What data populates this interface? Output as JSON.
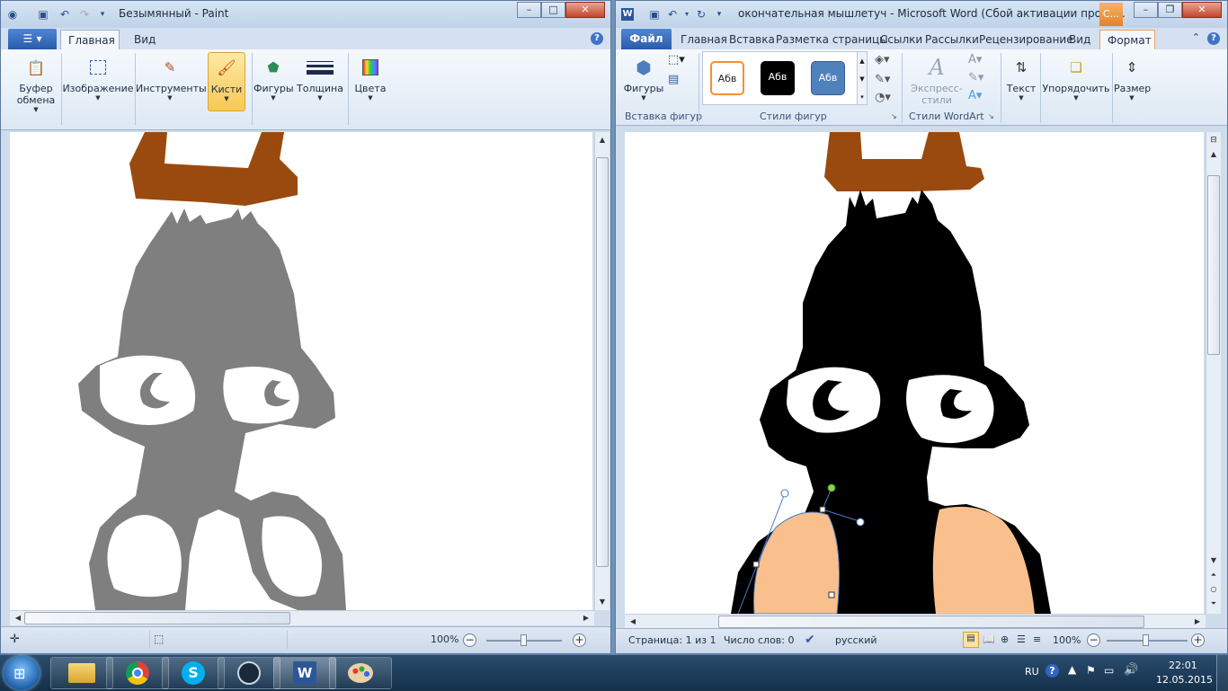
{
  "paint": {
    "title": "Безымянный - Paint",
    "tabs": [
      "Главная",
      "Вид"
    ],
    "groups": [
      {
        "label": "Буфер\nобмена",
        "icon": "clipboard-icon"
      },
      {
        "label": "Изображение",
        "icon": "select-icon"
      },
      {
        "label": "Инструменты",
        "icon": "tools-icon"
      },
      {
        "label": "Кисти",
        "icon": "brush-icon"
      },
      {
        "label": "Фигуры",
        "icon": "shapes-icon"
      },
      {
        "label": "Толщина",
        "icon": "thickness-icon"
      },
      {
        "label": "Цвета",
        "icon": "colors-icon"
      }
    ],
    "status": {
      "zoom": "100%"
    }
  },
  "word": {
    "title": "окончательная мышлетуч  -  Microsoft Word (Сбой активации проду...",
    "context_tab": "С...",
    "file_tab": "Файл",
    "tabs": [
      "Главная",
      "Вставка",
      "Разметка страницы",
      "Ссылки",
      "Рассылки",
      "Рецензирование",
      "Вид",
      "Формат"
    ],
    "groups": {
      "insert_shapes": {
        "label": "Вставка фигур",
        "shapes_button": "Фигуры"
      },
      "shape_styles": {
        "label": "Стили фигур",
        "styles": [
          "Абв",
          "Абв",
          "Абв"
        ]
      },
      "wordart": {
        "label": "Стили WordArt",
        "express_styles": "Экспресс-\nстили"
      },
      "text": {
        "label": "Текст"
      },
      "arrange": {
        "label": "Упорядочить"
      },
      "size": {
        "label": "Размер"
      }
    },
    "status": {
      "page": "Страница: 1 из 1",
      "words": "Число слов: 0",
      "language": "русский",
      "zoom": "100%"
    }
  },
  "taskbar": {
    "language": "RU",
    "time": "22:01",
    "date": "12.05.2015",
    "apps": [
      "explorer",
      "chrome",
      "skype",
      "steam",
      "word",
      "paint"
    ]
  },
  "colors": {
    "brown": "#9a4a0e",
    "gray": "#7f7f7f",
    "black": "#000000",
    "peach": "#f9c08e",
    "selection": "#4a78c2"
  }
}
